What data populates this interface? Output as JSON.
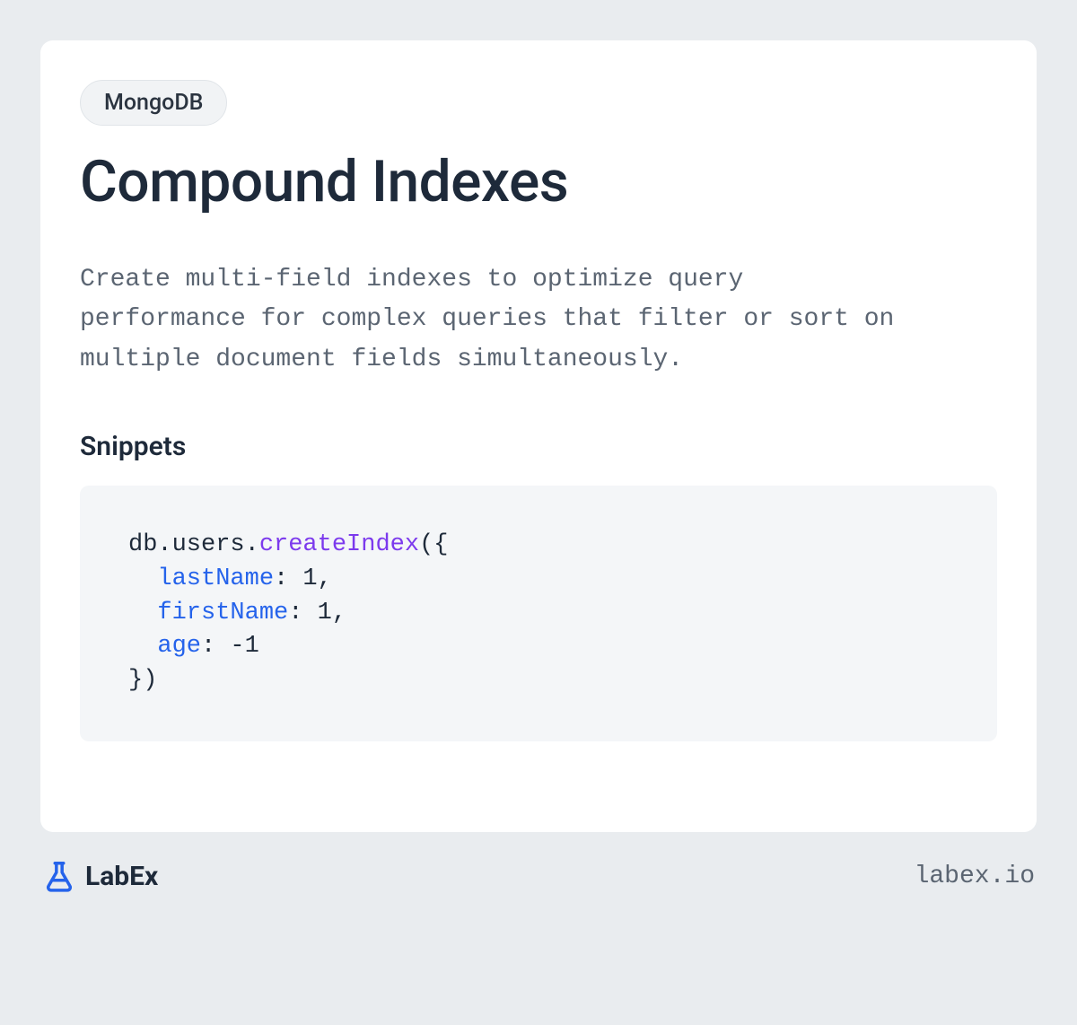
{
  "card": {
    "tag": "MongoDB",
    "title": "Compound Indexes",
    "description": "Create multi-field indexes to optimize query performance for complex queries that filter or sort on multiple document fields simultaneously.",
    "snippets_heading": "Snippets",
    "code": {
      "obj": "db.users",
      "method": "createIndex",
      "open": "({",
      "lines": [
        {
          "key": "lastName",
          "val": "1",
          "comma": ","
        },
        {
          "key": "firstName",
          "val": "1",
          "comma": ","
        },
        {
          "key": "age",
          "val": "-1",
          "comma": ""
        }
      ],
      "close": "})"
    }
  },
  "footer": {
    "brand_name": "LabEx",
    "site_url": "labex.io"
  }
}
